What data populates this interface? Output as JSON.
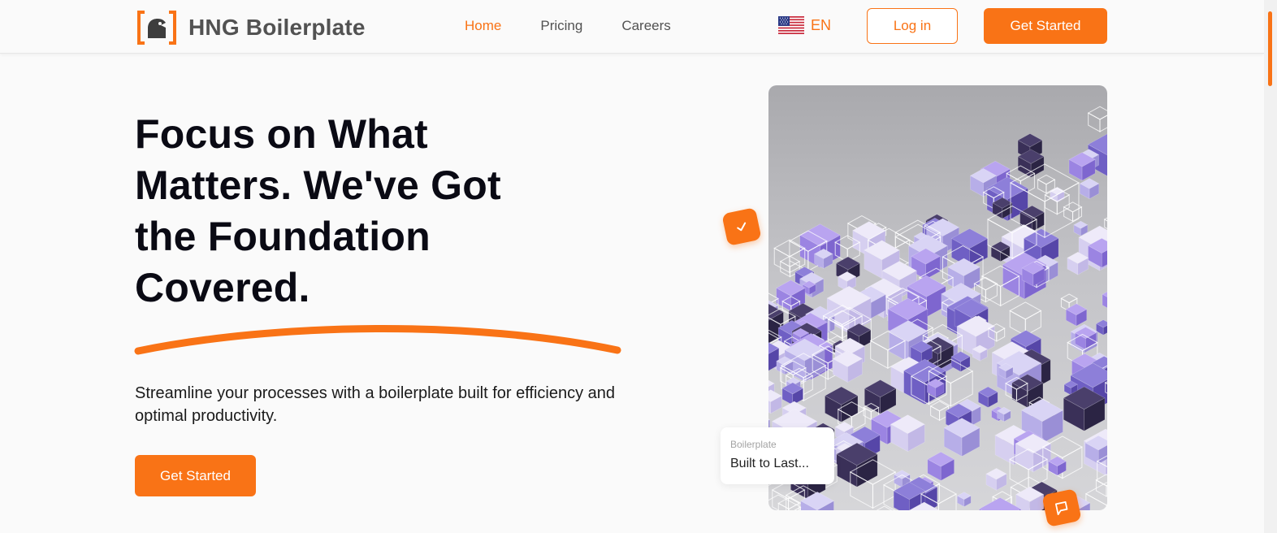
{
  "brand": {
    "name": "HNG Boilerplate",
    "logo_icon": "bracket-lock-logo"
  },
  "nav": {
    "items": [
      {
        "label": "Home",
        "active": true
      },
      {
        "label": "Pricing",
        "active": false
      },
      {
        "label": "Careers",
        "active": false
      }
    ]
  },
  "language": {
    "code": "EN",
    "flag_icon": "us-flag-icon"
  },
  "header_actions": {
    "login_label": "Log in",
    "cta_label": "Get Started"
  },
  "hero": {
    "title": "Focus on What Matters. We've Got the Foundation Covered.",
    "subtitle": "Streamline your processes with a boilerplate built for efficiency and optimal productivity.",
    "cta_label": "Get Started"
  },
  "floating_card": {
    "label": "Boilerplate",
    "title": "Built to Last..."
  },
  "colors": {
    "accent": "#f97316",
    "text_dark": "#0a0a14",
    "text_muted": "#525252",
    "background": "#fafafa"
  }
}
